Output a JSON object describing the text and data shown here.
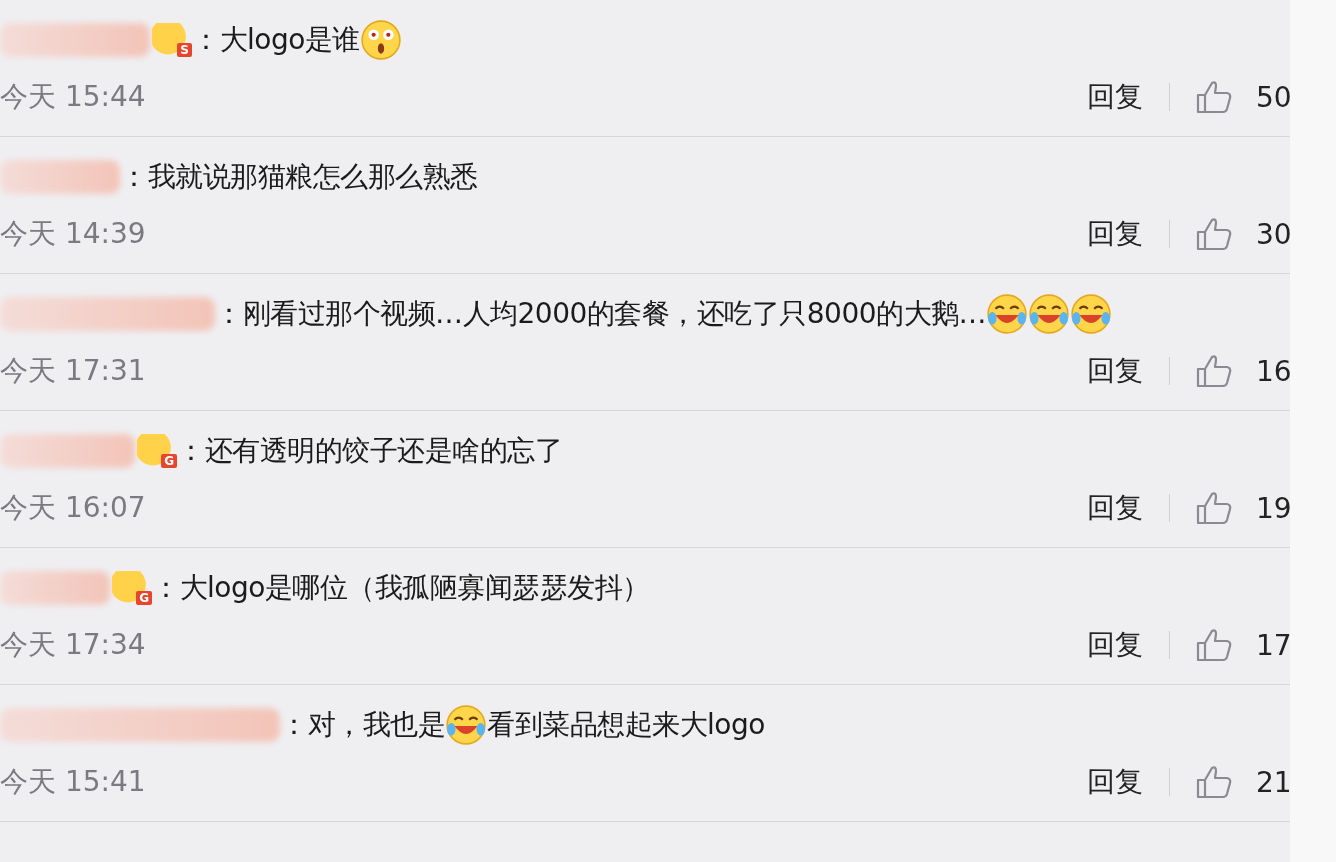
{
  "comments": [
    {
      "badge": "S",
      "content": [
        {
          "kind": "text",
          "text": "：大logo是谁"
        },
        {
          "kind": "surprised"
        }
      ],
      "time": "今天 15:44",
      "reply": "回复",
      "likes": "50"
    },
    {
      "content": [
        {
          "kind": "text",
          "text": "：我就说那猫粮怎么那么熟悉"
        }
      ],
      "time": "今天 14:39",
      "reply": "回复",
      "likes": "30"
    },
    {
      "content": [
        {
          "kind": "text",
          "text": "：刚看过那个视频…人均2000的套餐，还吃了只8000的大鹅…"
        },
        {
          "kind": "laughing"
        },
        {
          "kind": "laughing"
        },
        {
          "kind": "laughing"
        }
      ],
      "time": "今天 17:31",
      "reply": "回复",
      "likes": "16"
    },
    {
      "badge": "G",
      "content": [
        {
          "kind": "text",
          "text": "：还有透明的饺子还是啥的忘了"
        }
      ],
      "time": "今天 16:07",
      "reply": "回复",
      "likes": "19"
    },
    {
      "badge": "G",
      "content": [
        {
          "kind": "text",
          "text": "：大logo是哪位（我孤陋寡闻瑟瑟发抖）"
        }
      ],
      "time": "今天 17:34",
      "reply": "回复",
      "likes": "17"
    },
    {
      "content": [
        {
          "kind": "text",
          "text": "：对，我也是"
        },
        {
          "kind": "laughing"
        },
        {
          "kind": "text",
          "text": "看到菜品想起来大logo"
        }
      ],
      "time": "今天 15:41",
      "reply": "回复",
      "likes": "21"
    }
  ]
}
